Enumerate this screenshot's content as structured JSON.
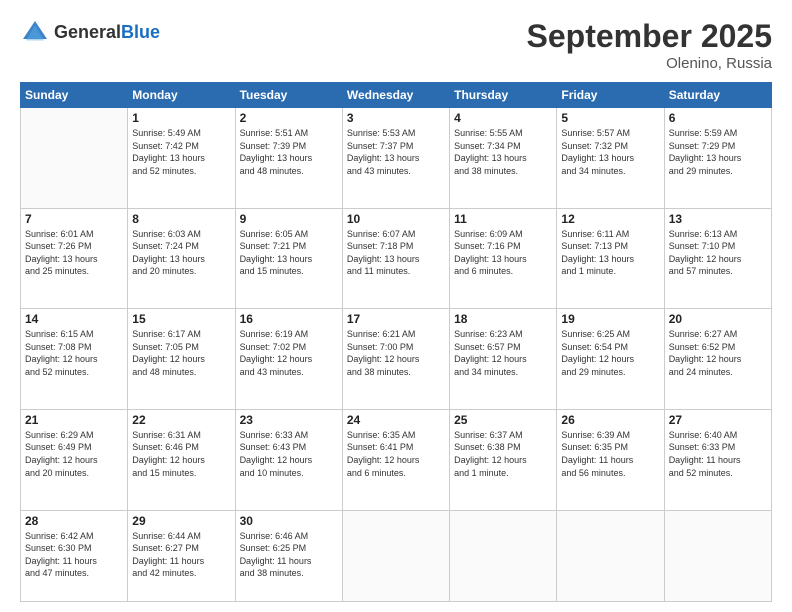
{
  "header": {
    "logo_general": "General",
    "logo_blue": "Blue",
    "month": "September 2025",
    "location": "Olenino, Russia"
  },
  "weekdays": [
    "Sunday",
    "Monday",
    "Tuesday",
    "Wednesday",
    "Thursday",
    "Friday",
    "Saturday"
  ],
  "weeks": [
    [
      {
        "day": "",
        "info": ""
      },
      {
        "day": "1",
        "info": "Sunrise: 5:49 AM\nSunset: 7:42 PM\nDaylight: 13 hours\nand 52 minutes."
      },
      {
        "day": "2",
        "info": "Sunrise: 5:51 AM\nSunset: 7:39 PM\nDaylight: 13 hours\nand 48 minutes."
      },
      {
        "day": "3",
        "info": "Sunrise: 5:53 AM\nSunset: 7:37 PM\nDaylight: 13 hours\nand 43 minutes."
      },
      {
        "day": "4",
        "info": "Sunrise: 5:55 AM\nSunset: 7:34 PM\nDaylight: 13 hours\nand 38 minutes."
      },
      {
        "day": "5",
        "info": "Sunrise: 5:57 AM\nSunset: 7:32 PM\nDaylight: 13 hours\nand 34 minutes."
      },
      {
        "day": "6",
        "info": "Sunrise: 5:59 AM\nSunset: 7:29 PM\nDaylight: 13 hours\nand 29 minutes."
      }
    ],
    [
      {
        "day": "7",
        "info": "Sunrise: 6:01 AM\nSunset: 7:26 PM\nDaylight: 13 hours\nand 25 minutes."
      },
      {
        "day": "8",
        "info": "Sunrise: 6:03 AM\nSunset: 7:24 PM\nDaylight: 13 hours\nand 20 minutes."
      },
      {
        "day": "9",
        "info": "Sunrise: 6:05 AM\nSunset: 7:21 PM\nDaylight: 13 hours\nand 15 minutes."
      },
      {
        "day": "10",
        "info": "Sunrise: 6:07 AM\nSunset: 7:18 PM\nDaylight: 13 hours\nand 11 minutes."
      },
      {
        "day": "11",
        "info": "Sunrise: 6:09 AM\nSunset: 7:16 PM\nDaylight: 13 hours\nand 6 minutes."
      },
      {
        "day": "12",
        "info": "Sunrise: 6:11 AM\nSunset: 7:13 PM\nDaylight: 13 hours\nand 1 minute."
      },
      {
        "day": "13",
        "info": "Sunrise: 6:13 AM\nSunset: 7:10 PM\nDaylight: 12 hours\nand 57 minutes."
      }
    ],
    [
      {
        "day": "14",
        "info": "Sunrise: 6:15 AM\nSunset: 7:08 PM\nDaylight: 12 hours\nand 52 minutes."
      },
      {
        "day": "15",
        "info": "Sunrise: 6:17 AM\nSunset: 7:05 PM\nDaylight: 12 hours\nand 48 minutes."
      },
      {
        "day": "16",
        "info": "Sunrise: 6:19 AM\nSunset: 7:02 PM\nDaylight: 12 hours\nand 43 minutes."
      },
      {
        "day": "17",
        "info": "Sunrise: 6:21 AM\nSunset: 7:00 PM\nDaylight: 12 hours\nand 38 minutes."
      },
      {
        "day": "18",
        "info": "Sunrise: 6:23 AM\nSunset: 6:57 PM\nDaylight: 12 hours\nand 34 minutes."
      },
      {
        "day": "19",
        "info": "Sunrise: 6:25 AM\nSunset: 6:54 PM\nDaylight: 12 hours\nand 29 minutes."
      },
      {
        "day": "20",
        "info": "Sunrise: 6:27 AM\nSunset: 6:52 PM\nDaylight: 12 hours\nand 24 minutes."
      }
    ],
    [
      {
        "day": "21",
        "info": "Sunrise: 6:29 AM\nSunset: 6:49 PM\nDaylight: 12 hours\nand 20 minutes."
      },
      {
        "day": "22",
        "info": "Sunrise: 6:31 AM\nSunset: 6:46 PM\nDaylight: 12 hours\nand 15 minutes."
      },
      {
        "day": "23",
        "info": "Sunrise: 6:33 AM\nSunset: 6:43 PM\nDaylight: 12 hours\nand 10 minutes."
      },
      {
        "day": "24",
        "info": "Sunrise: 6:35 AM\nSunset: 6:41 PM\nDaylight: 12 hours\nand 6 minutes."
      },
      {
        "day": "25",
        "info": "Sunrise: 6:37 AM\nSunset: 6:38 PM\nDaylight: 12 hours\nand 1 minute."
      },
      {
        "day": "26",
        "info": "Sunrise: 6:39 AM\nSunset: 6:35 PM\nDaylight: 11 hours\nand 56 minutes."
      },
      {
        "day": "27",
        "info": "Sunrise: 6:40 AM\nSunset: 6:33 PM\nDaylight: 11 hours\nand 52 minutes."
      }
    ],
    [
      {
        "day": "28",
        "info": "Sunrise: 6:42 AM\nSunset: 6:30 PM\nDaylight: 11 hours\nand 47 minutes."
      },
      {
        "day": "29",
        "info": "Sunrise: 6:44 AM\nSunset: 6:27 PM\nDaylight: 11 hours\nand 42 minutes."
      },
      {
        "day": "30",
        "info": "Sunrise: 6:46 AM\nSunset: 6:25 PM\nDaylight: 11 hours\nand 38 minutes."
      },
      {
        "day": "",
        "info": ""
      },
      {
        "day": "",
        "info": ""
      },
      {
        "day": "",
        "info": ""
      },
      {
        "day": "",
        "info": ""
      }
    ]
  ]
}
